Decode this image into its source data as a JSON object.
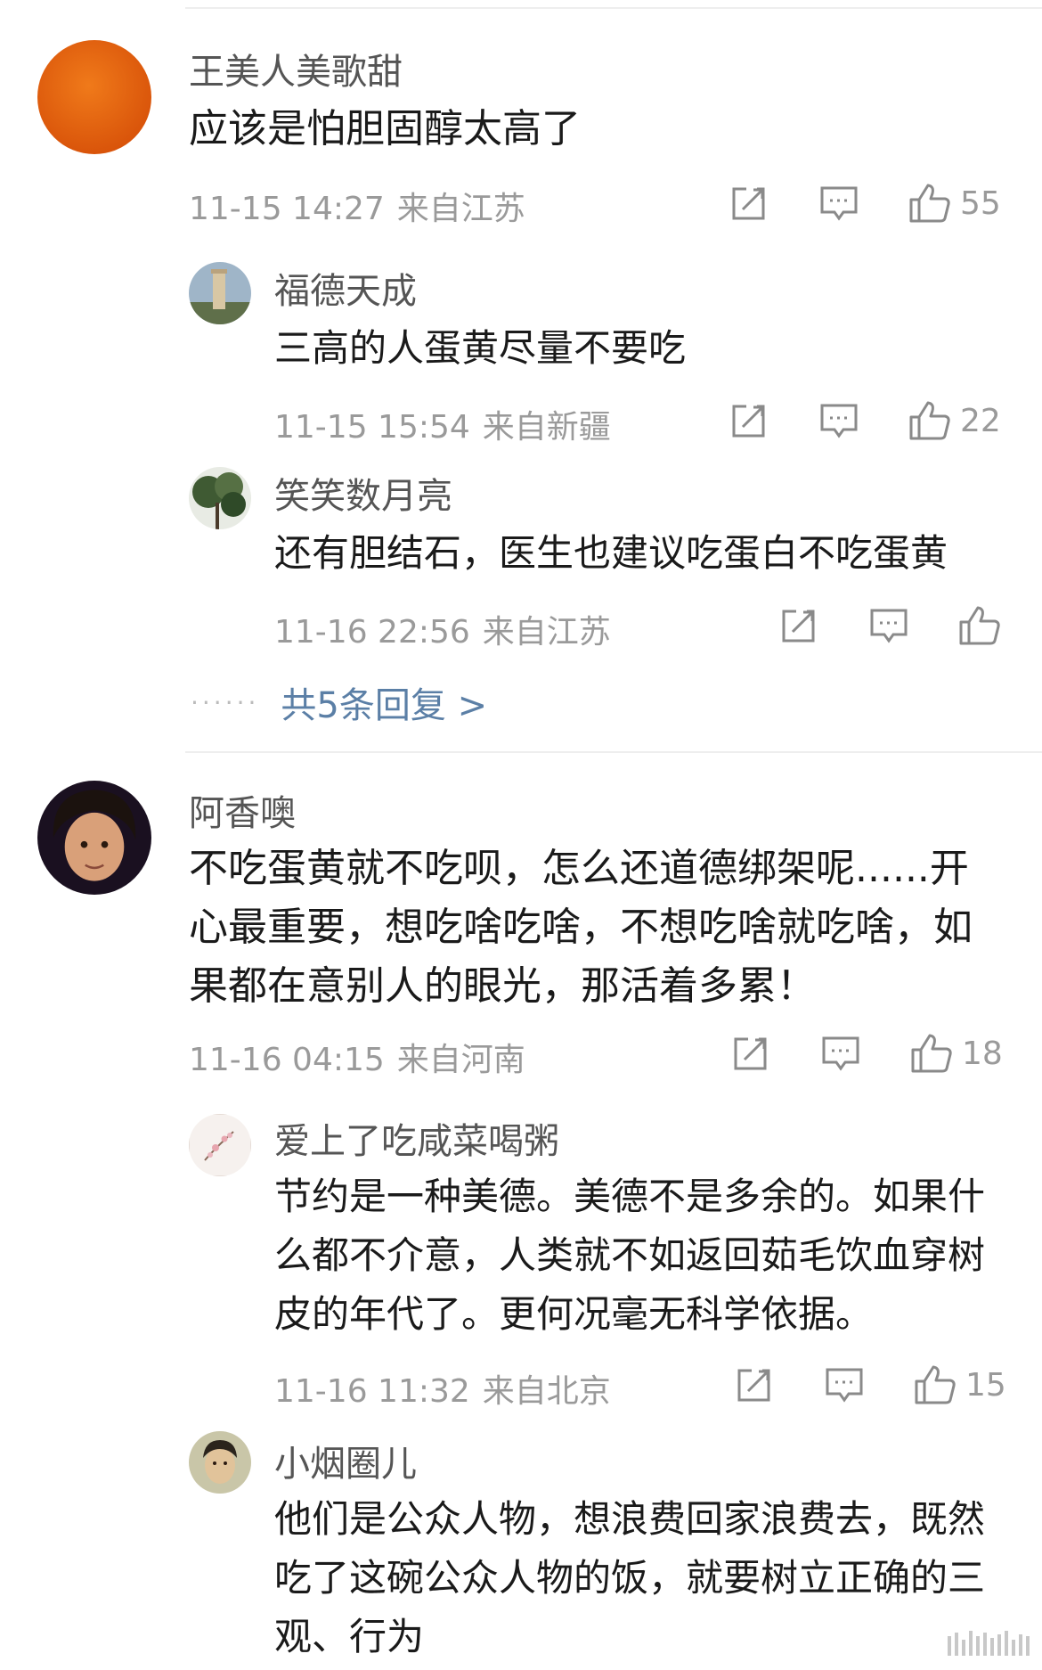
{
  "comments": [
    {
      "user": "王美人美歌甜",
      "text": "应该是怕胆固醇太高了",
      "time": "11-15 14:27",
      "location": "来自江苏",
      "likes": "55",
      "replies": [
        {
          "user": "福德天成",
          "text": "三高的人蛋黄尽量不要吃",
          "time": "11-15 15:54",
          "location": "来自新疆",
          "likes": "22"
        },
        {
          "user": "笑笑数月亮",
          "text": "还有胆结石，医生也建议吃蛋白不吃蛋黄",
          "time": "11-16 22:56",
          "location": "来自江苏",
          "likes": ""
        }
      ],
      "more_replies": "共5条回复 >"
    },
    {
      "user": "阿香噢",
      "text": "不吃蛋黄就不吃呗，怎么还道德绑架呢......开心最重要，想吃啥吃啥，不想吃啥就吃啥，如果都在意别人的眼光，那活着多累！",
      "time": "11-16 04:15",
      "location": "来自河南",
      "likes": "18",
      "replies": [
        {
          "user": "爱上了吃咸菜喝粥",
          "text": "节约是一种美德。美德不是多余的。如果什么都不介意，人类就不如返回茹毛饮血穿树皮的年代了。更何况毫无科学依据。",
          "time": "11-16 11:32",
          "location": "来自北京",
          "likes": "15"
        },
        {
          "user": "小烟圈儿",
          "text": "他们是公众人物，想浪费回家浪费去，既然吃了这碗公众人物的饭，就要树立正确的三观、行为",
          "time": "",
          "location": "",
          "likes": ""
        }
      ]
    }
  ],
  "icons": {
    "repost": "share-icon",
    "comment": "comment-icon",
    "like": "thumb-up-icon"
  },
  "colors": {
    "link": "#5b7fa6",
    "meta": "#9a9a9a",
    "name": "#555555",
    "avatar1": "#e5620f"
  }
}
